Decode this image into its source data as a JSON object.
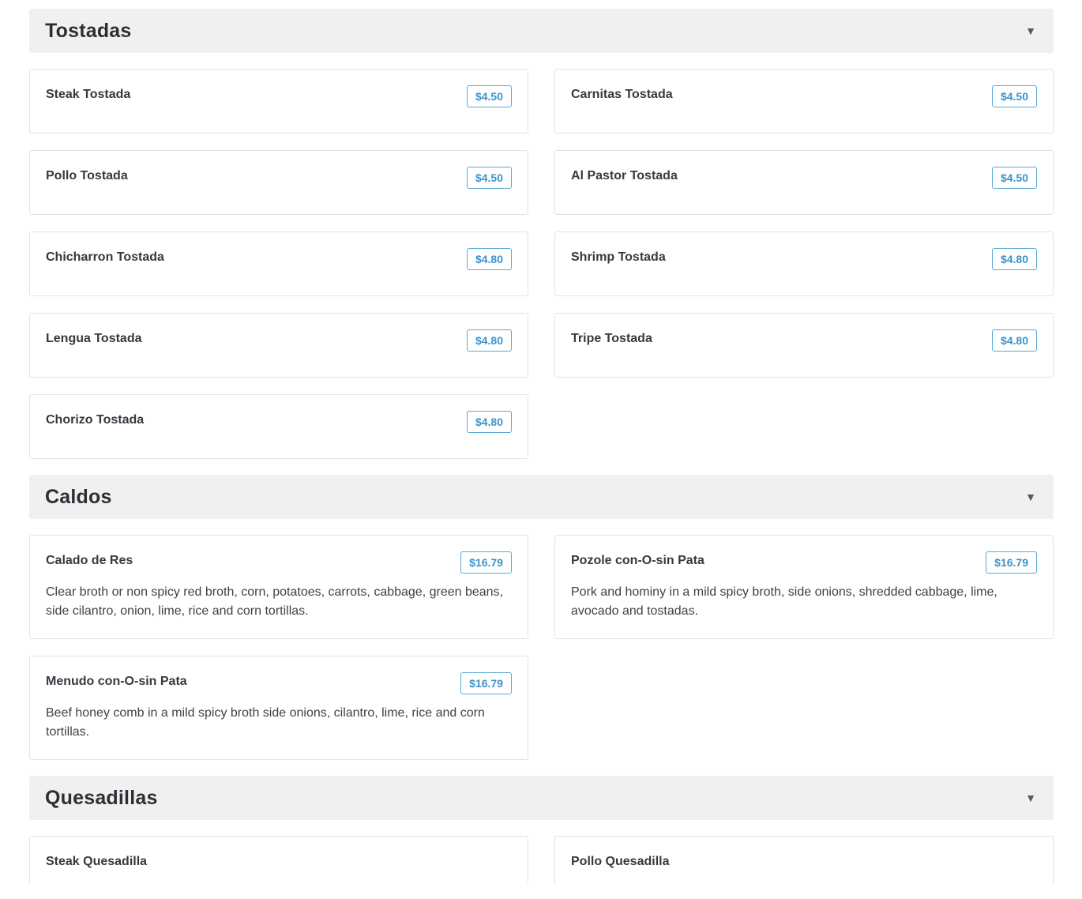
{
  "sections": [
    {
      "title": "Tostadas",
      "toggle_icon": "triangle-down-icon",
      "items": [
        {
          "name": "Steak Tostada",
          "price": "$4.50",
          "description": ""
        },
        {
          "name": "Carnitas Tostada",
          "price": "$4.50",
          "description": ""
        },
        {
          "name": "Pollo Tostada",
          "price": "$4.50",
          "description": ""
        },
        {
          "name": "Al Pastor Tostada",
          "price": "$4.50",
          "description": ""
        },
        {
          "name": "Chicharron Tostada",
          "price": "$4.80",
          "description": ""
        },
        {
          "name": "Shrimp Tostada",
          "price": "$4.80",
          "description": ""
        },
        {
          "name": "Lengua Tostada",
          "price": "$4.80",
          "description": ""
        },
        {
          "name": "Tripe Tostada",
          "price": "$4.80",
          "description": ""
        },
        {
          "name": "Chorizo Tostada",
          "price": "$4.80",
          "description": ""
        }
      ]
    },
    {
      "title": "Caldos",
      "toggle_icon": "triangle-down-icon",
      "items": [
        {
          "name": "Calado de Res",
          "price": "$16.79",
          "description": "Clear broth or non spicy red broth, corn, potatoes, carrots, cabbage, green beans, side cilantro, onion, lime, rice and corn tortillas."
        },
        {
          "name": "Pozole con-O-sin Pata",
          "price": "$16.79",
          "description": "Pork and hominy in a mild spicy broth, side onions, shredded cabbage, lime, avocado and tostadas."
        },
        {
          "name": "Menudo con-O-sin Pata",
          "price": "$16.79",
          "description": "Beef honey comb in a mild spicy broth side onions, cilantro, lime, rice and corn tortillas."
        }
      ]
    },
    {
      "title": "Quesadillas",
      "toggle_icon": "triangle-down-icon",
      "partial": true,
      "items": [
        {
          "name": "Steak Quesadilla",
          "price": "",
          "description": ""
        },
        {
          "name": "Pollo Quesadilla",
          "price": "",
          "description": ""
        }
      ]
    }
  ],
  "colors": {
    "header_bg": "#f0f0f0",
    "price_accent": "#3a93c9",
    "card_border": "#e2e2e2"
  }
}
